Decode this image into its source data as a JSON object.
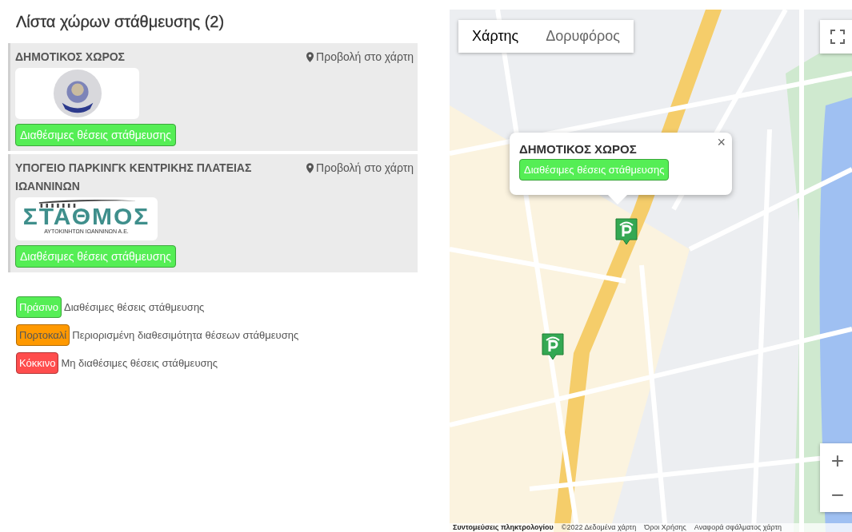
{
  "title": "Λίστα χώρων στάθμευσης (2)",
  "places": [
    {
      "name": "ΔΗΜΟΤΙΚΟΣ ΧΩΡΟΣ",
      "link": "Προβολή στο χάρτη",
      "logo": {
        "kind": "emblem"
      },
      "status": {
        "label": "Διαθέσιμες θέσεις στάθμευσης",
        "color": "#55ee55"
      }
    },
    {
      "name": "ΥΠΟΓΕΙΟ ΠΑΡΚΙΝΓΚ ΚΕΝΤΡΙΚΗΣ ΠΛΑΤΕΙΑΣ ΙΩΑΝΝΙΝΩΝ",
      "link": "Προβολή στο χάρτη",
      "logo": {
        "kind": "wordmark",
        "title": "ΣΤΑΘΜΟΣ",
        "subtitle": "ΑΥΤΟΚΙΝΗΤΩΝ ΙΩΑΝΝΙΝΩΝ Α.Ε."
      },
      "status": {
        "label": "Διαθέσιμες θέσεις στάθμευσης",
        "color": "#55ee55"
      }
    }
  ],
  "legend": [
    {
      "label": "Πράσινο",
      "description": "Διαθέσιμες θέσεις στάθμευσης",
      "color": "#55ee55"
    },
    {
      "label": "Πορτοκαλί",
      "description": "Περιορισμένη διαθεσιμότητα θέσεων στάθμευσης",
      "color": "#ff9900"
    },
    {
      "label": "Κόκκινο",
      "description": "Μη διαθέσιμες θέσεις στάθμευσης",
      "color": "#ff4d4d"
    }
  ],
  "map": {
    "map_types": [
      {
        "label": "Χάρτης",
        "selected": true
      },
      {
        "label": "Δορυφόρος",
        "selected": false
      }
    ],
    "popup": {
      "title": "ΔΗΜΟΤΙΚΟΣ ΧΩΡΟΣ",
      "close": "×",
      "status": {
        "label": "Διαθέσιμες θέσεις στάθμευσης",
        "color": "#55ee55"
      }
    },
    "zoom_in": "+",
    "zoom_out": "−",
    "attribution": [
      "Συντομεύσεις πληκτρολογίου",
      "©2022 Δεδομένα χάρτη",
      "Όροι Χρήσης",
      "Αναφορά σφάλματος χάρτη"
    ]
  }
}
